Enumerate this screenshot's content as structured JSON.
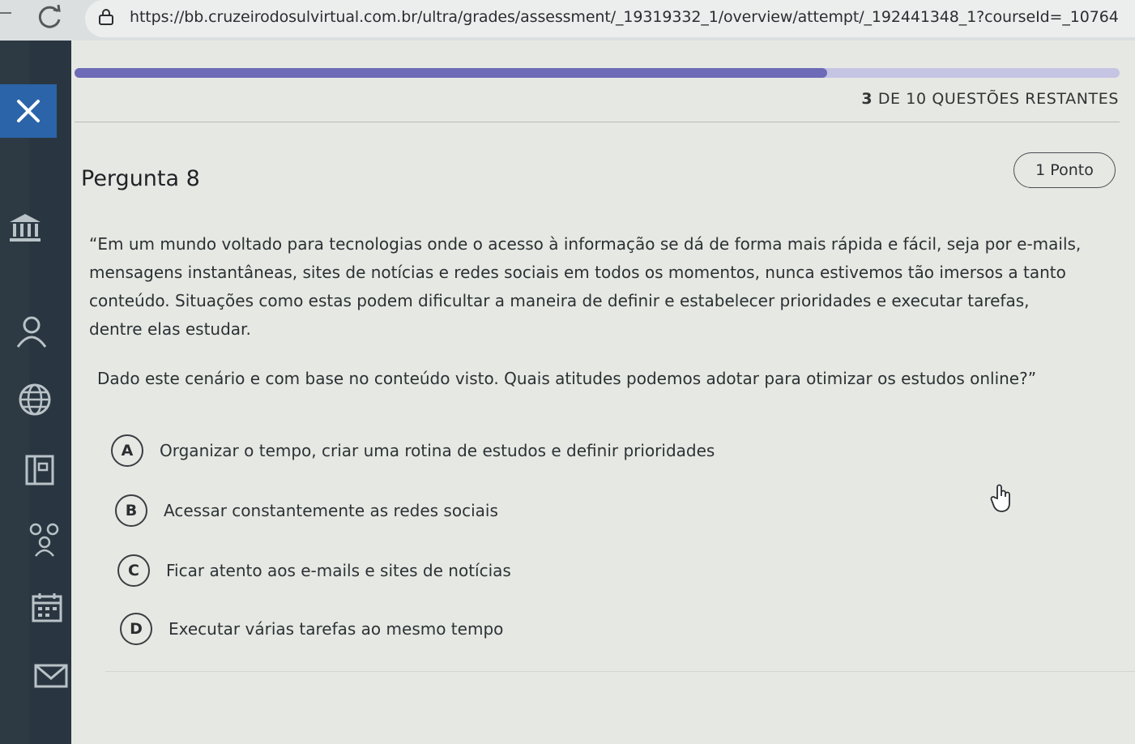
{
  "browser": {
    "url": "https://bb.cruzeirodosulvirtual.com.br/ultra/grades/assessment/_19319332_1/overview/attempt/_192441348_1?courseId=_10764"
  },
  "nav": {
    "icons": [
      "close-icon",
      "institution-icon",
      "profile-icon",
      "globe-icon",
      "courses-icon",
      "groups-icon",
      "calendar-icon",
      "messages-icon"
    ]
  },
  "progress": {
    "fraction": 0.72,
    "remaining_count": "3",
    "remaining_suffix": "DE 10 QUESTÕES RESTANTES"
  },
  "question": {
    "title": "Pergunta 8",
    "points": "1 Ponto",
    "text_lines": [
      "“Em um mundo voltado para tecnologias onde o acesso à informação se dá de forma mais rápida e fácil, seja por e-mails,",
      "mensagens instantâneas, sites de notícias e redes sociais em todos os momentos, nunca estivemos tão imersos a tanto",
      "conteúdo. Situações como estas podem dificultar a maneira de definir e estabelecer prioridades e executar tarefas,",
      "dentre elas estudar."
    ],
    "prompt": "Dado este cenário e com base no conteúdo visto. Quais atitudes podemos adotar para otimizar os estudos online?”"
  },
  "options": [
    {
      "letter": "A",
      "label": "Organizar o tempo, criar uma rotina de estudos e definir prioridades"
    },
    {
      "letter": "B",
      "label": "Acessar constantemente as redes sociais"
    },
    {
      "letter": "C",
      "label": "Ficar atento aos e-mails e sites de notícias"
    },
    {
      "letter": "D",
      "label": "Executar várias tarefas ao mesmo tempo"
    }
  ],
  "colors": {
    "progress_fill": "#6d6ab7",
    "progress_track": "#c6c4e3",
    "close_button": "#2b64a8",
    "nav_background": "#2d3a44"
  }
}
